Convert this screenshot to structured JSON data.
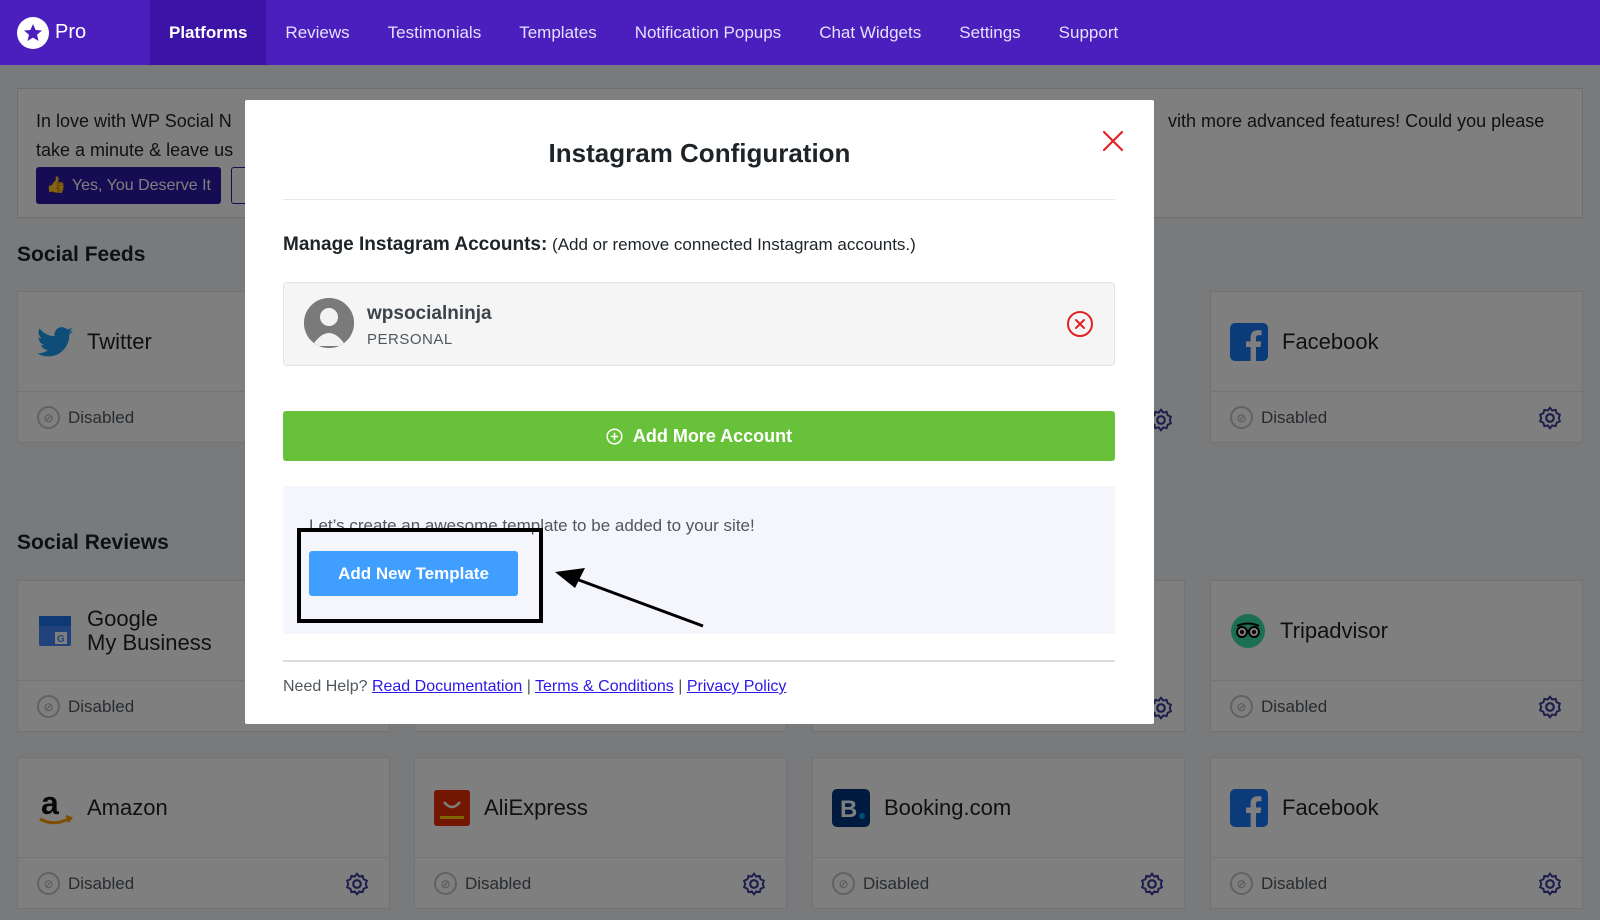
{
  "brand": {
    "name": "Pro"
  },
  "nav": [
    {
      "label": "Platforms",
      "active": true
    },
    {
      "label": "Reviews"
    },
    {
      "label": "Testimonials"
    },
    {
      "label": "Templates"
    },
    {
      "label": "Notification Popups"
    },
    {
      "label": "Chat Widgets"
    },
    {
      "label": "Settings"
    },
    {
      "label": "Support"
    }
  ],
  "notice": {
    "line1_left": "In love with WP Social N",
    "line1_right": "vith more advanced features! Could you please",
    "line2_left": "take a minute & leave us",
    "yes_button": "Yes, You Deserve It"
  },
  "sections": {
    "feeds_title": "Social Feeds",
    "reviews_title": "Social Reviews"
  },
  "cards": {
    "twitter": {
      "name": "Twitter",
      "status": "Disabled"
    },
    "facebook_feed": {
      "name": "Facebook",
      "status": "Disabled"
    },
    "google": {
      "name_line1": "Google",
      "name_line2": "My Business",
      "status": "Disabled"
    },
    "tripadvisor": {
      "name": "Tripadvisor",
      "status": "Disabled"
    },
    "amazon": {
      "name": "Amazon",
      "status": "Disabled"
    },
    "aliexpress": {
      "name": "AliExpress",
      "status": "Disabled"
    },
    "booking": {
      "name": "Booking.com",
      "status": "Disabled"
    },
    "facebook_review": {
      "name": "Facebook",
      "status": "Disabled"
    }
  },
  "modal": {
    "title": "Instagram Configuration",
    "manage_label": "Manage Instagram Accounts:",
    "manage_hint": "(Add or remove connected Instagram accounts.)",
    "account": {
      "username": "wpsocialninja",
      "type": "PERSONAL"
    },
    "add_account_label": "Add More Account",
    "template_prompt": "Let’s create an awesome template to be added to your site!",
    "add_template_label": "Add New Template",
    "help_prefix": "Need Help?",
    "links": {
      "docs": "Read Documentation",
      "terms": "Terms & Conditions",
      "privacy": "Privacy Policy"
    },
    "separator": "|"
  },
  "colors": {
    "topbar": "#4b1fbd",
    "accent_green": "#67c23a",
    "accent_blue": "#409eff",
    "close_red": "#e02424"
  }
}
